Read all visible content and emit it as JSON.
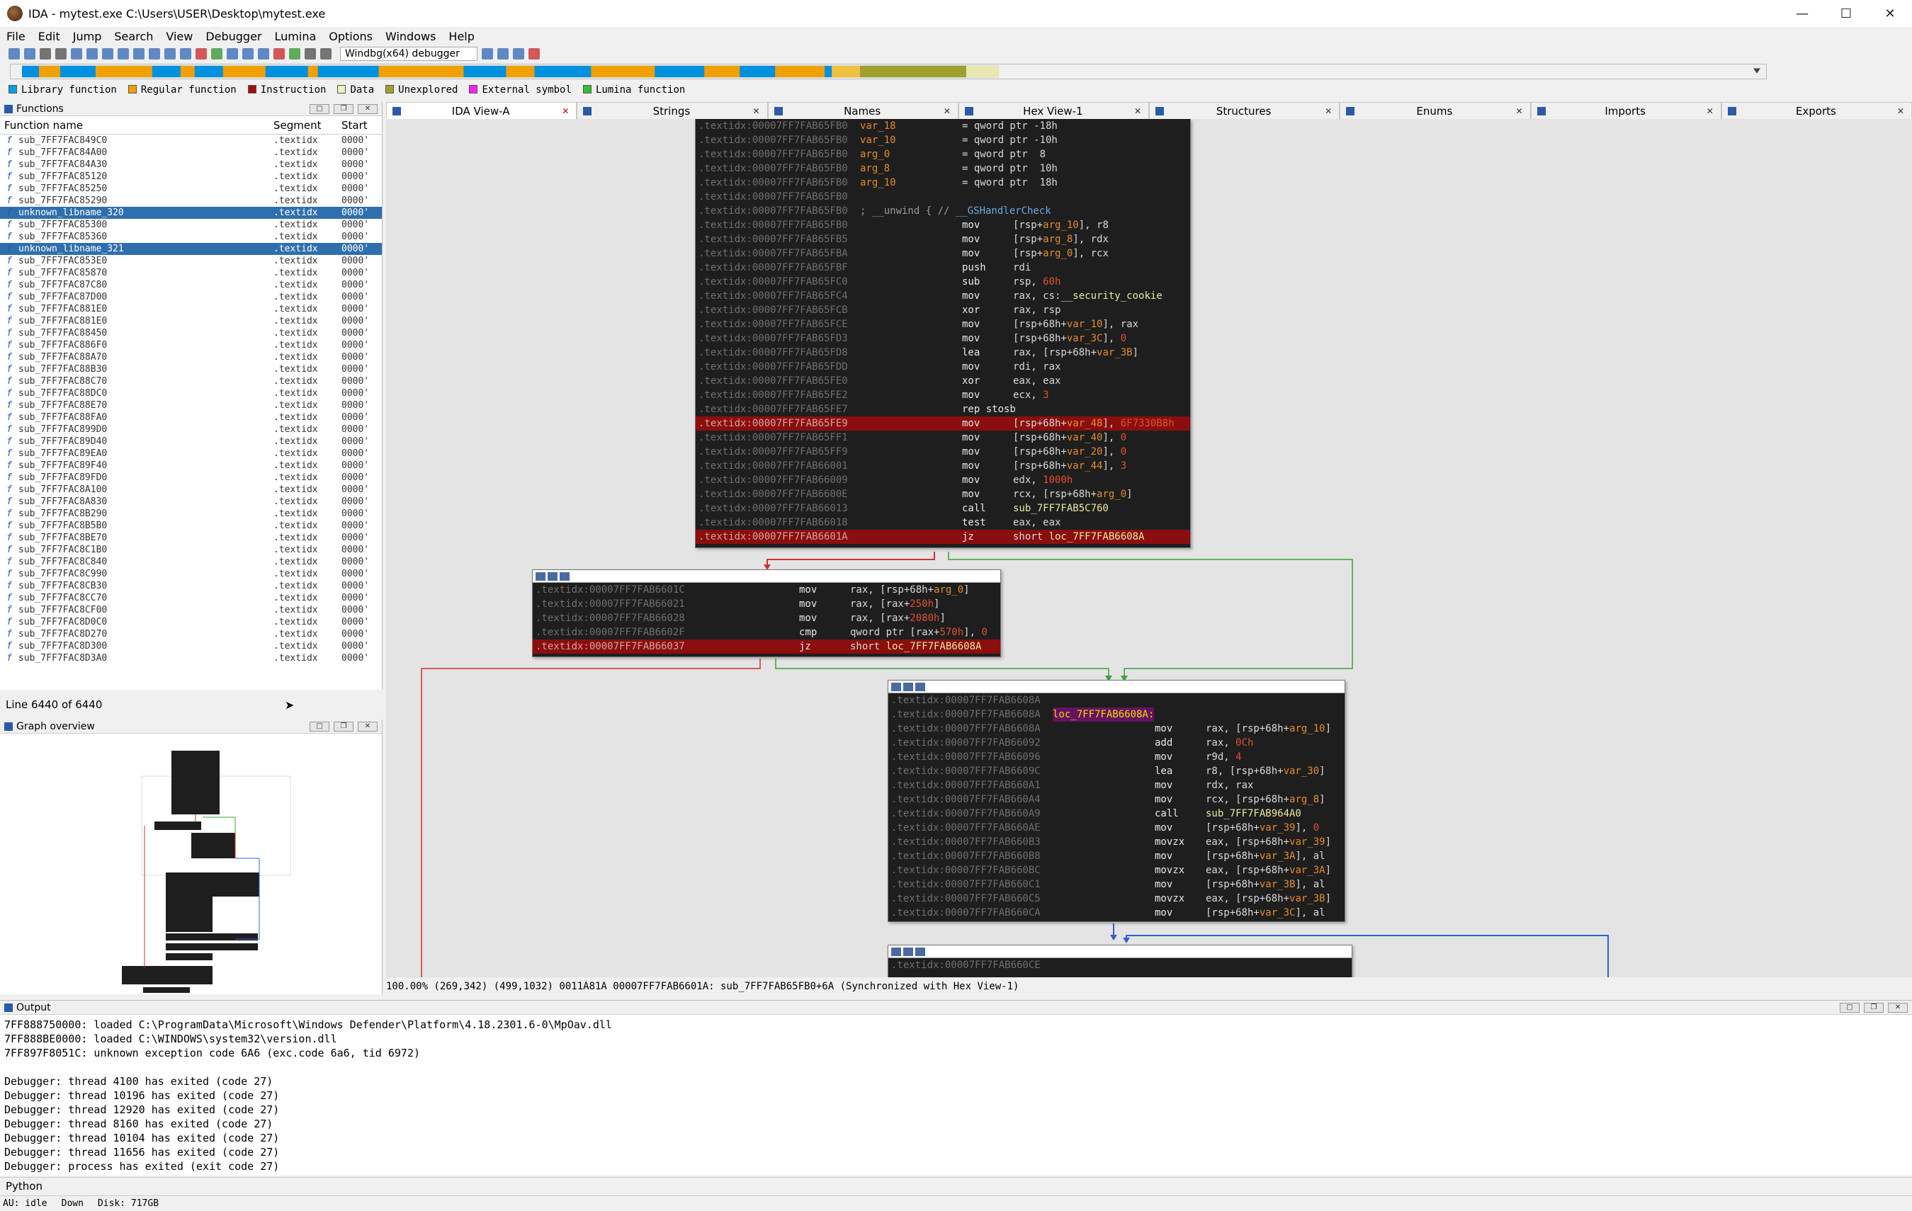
{
  "title": "IDA - mytest.exe C:\\Users\\USER\\Desktop\\mytest.exe",
  "window_controls": {
    "minimize": "—",
    "maximize": "☐",
    "close": "✕"
  },
  "menu": [
    "File",
    "Edit",
    "Jump",
    "Search",
    "View",
    "Debugger",
    "Lumina",
    "Options",
    "Windows",
    "Help"
  ],
  "toolbar": {
    "debugger_select": "Windbg(x64) debugger"
  },
  "legend": [
    {
      "label": "Library function",
      "color": "#00a0e8"
    },
    {
      "label": "Regular function",
      "color": "#f0a000"
    },
    {
      "label": "Instruction",
      "color": "#a01010"
    },
    {
      "label": "Data",
      "color": "#f0f0c0"
    },
    {
      "label": "Unexplored",
      "color": "#a0a030"
    },
    {
      "label": "External symbol",
      "color": "#ff20ff"
    },
    {
      "label": "Lumina function",
      "color": "#30c030"
    }
  ],
  "functions_panel": {
    "title": "Functions",
    "col_name": "Function name",
    "col_segment": "Segment",
    "col_start": "Start",
    "rows": [
      {
        "name": "sub_7FF7FAC849C0",
        "seg": ".textidx",
        "start": "0000'"
      },
      {
        "name": "sub_7FF7FAC84A00",
        "seg": ".textidx",
        "start": "0000'"
      },
      {
        "name": "sub_7FF7FAC84A30",
        "seg": ".textidx",
        "start": "0000'"
      },
      {
        "name": "sub_7FF7FAC85120",
        "seg": ".textidx",
        "start": "0000'"
      },
      {
        "name": "sub_7FF7FAC85250",
        "seg": ".textidx",
        "start": "0000'"
      },
      {
        "name": "sub_7FF7FAC85290",
        "seg": ".textidx",
        "start": "0000'"
      },
      {
        "name": "unknown_libname_320",
        "seg": ".textidx",
        "start": "0000'",
        "sel": true
      },
      {
        "name": "sub_7FF7FAC85300",
        "seg": ".textidx",
        "start": "0000'"
      },
      {
        "name": "sub_7FF7FAC85360",
        "seg": ".textidx",
        "start": "0000'"
      },
      {
        "name": "unknown_libname_321",
        "seg": ".textidx",
        "start": "0000'",
        "sel": true
      },
      {
        "name": "sub_7FF7FAC853E0",
        "seg": ".textidx",
        "start": "0000'"
      },
      {
        "name": "sub_7FF7FAC85870",
        "seg": ".textidx",
        "start": "0000'"
      },
      {
        "name": "sub_7FF7FAC87C80",
        "seg": ".textidx",
        "start": "0000'"
      },
      {
        "name": "sub_7FF7FAC87D00",
        "seg": ".textidx",
        "start": "0000'"
      },
      {
        "name": "sub_7FF7FAC881E0",
        "seg": ".textidx",
        "start": "0000'"
      },
      {
        "name": "sub_7FF7FAC881E0",
        "seg": ".textidx",
        "start": "0000'"
      },
      {
        "name": "sub_7FF7FAC88450",
        "seg": ".textidx",
        "start": "0000'"
      },
      {
        "name": "sub_7FF7FAC886F0",
        "seg": ".textidx",
        "start": "0000'"
      },
      {
        "name": "sub_7FF7FAC88A70",
        "seg": ".textidx",
        "start": "0000'"
      },
      {
        "name": "sub_7FF7FAC88B30",
        "seg": ".textidx",
        "start": "0000'"
      },
      {
        "name": "sub_7FF7FAC88C70",
        "seg": ".textidx",
        "start": "0000'"
      },
      {
        "name": "sub_7FF7FAC88DC0",
        "seg": ".textidx",
        "start": "0000'"
      },
      {
        "name": "sub_7FF7FAC88E70",
        "seg": ".textidx",
        "start": "0000'"
      },
      {
        "name": "sub_7FF7FAC88FA0",
        "seg": ".textidx",
        "start": "0000'"
      },
      {
        "name": "sub_7FF7FAC899D0",
        "seg": ".textidx",
        "start": "0000'"
      },
      {
        "name": "sub_7FF7FAC89D40",
        "seg": ".textidx",
        "start": "0000'"
      },
      {
        "name": "sub_7FF7FAC89EA0",
        "seg": ".textidx",
        "start": "0000'"
      },
      {
        "name": "sub_7FF7FAC89F40",
        "seg": ".textidx",
        "start": "0000'"
      },
      {
        "name": "sub_7FF7FAC89FD0",
        "seg": ".textidx",
        "start": "0000'"
      },
      {
        "name": "sub_7FF7FAC8A100",
        "seg": ".textidx",
        "start": "0000'"
      },
      {
        "name": "sub_7FF7FAC8A830",
        "seg": ".textidx",
        "start": "0000'"
      },
      {
        "name": "sub_7FF7FAC8B290",
        "seg": ".textidx",
        "start": "0000'"
      },
      {
        "name": "sub_7FF7FAC8B5B0",
        "seg": ".textidx",
        "start": "0000'"
      },
      {
        "name": "sub_7FF7FAC8BE70",
        "seg": ".textidx",
        "start": "0000'"
      },
      {
        "name": "sub_7FF7FAC8C1B0",
        "seg": ".textidx",
        "start": "0000'"
      },
      {
        "name": "sub_7FF7FAC8C840",
        "seg": ".textidx",
        "start": "0000'"
      },
      {
        "name": "sub_7FF7FAC8C990",
        "seg": ".textidx",
        "start": "0000'"
      },
      {
        "name": "sub_7FF7FAC8CB30",
        "seg": ".textidx",
        "start": "0000'"
      },
      {
        "name": "sub_7FF7FAC8CC70",
        "seg": ".textidx",
        "start": "0000'"
      },
      {
        "name": "sub_7FF7FAC8CF00",
        "seg": ".textidx",
        "start": "0000'"
      },
      {
        "name": "sub_7FF7FAC8D0C0",
        "seg": ".textidx",
        "start": "0000'"
      },
      {
        "name": "sub_7FF7FAC8D270",
        "seg": ".textidx",
        "start": "0000'"
      },
      {
        "name": "sub_7FF7FAC8D300",
        "seg": ".textidx",
        "start": "0000'"
      },
      {
        "name": "sub_7FF7FAC8D3A0",
        "seg": ".textidx",
        "start": "0000'"
      }
    ],
    "line_count": "Line 6440 of 6440"
  },
  "graph_overview": {
    "title": "Graph overview"
  },
  "tabs": [
    {
      "label": "IDA View-A",
      "active": true
    },
    {
      "label": "Strings"
    },
    {
      "label": "Names"
    },
    {
      "label": "Hex View-1"
    },
    {
      "label": "Structures"
    },
    {
      "label": "Enums"
    },
    {
      "label": "Imports"
    },
    {
      "label": "Exports"
    }
  ],
  "block1": [
    {
      "a": ".textidx:00007FF7FAB65FB0",
      "l": "var_18",
      "m": "= qword ptr -18h",
      "t": "decl"
    },
    {
      "a": ".textidx:00007FF7FAB65FB0",
      "l": "var_10",
      "m": "= qword ptr -10h",
      "t": "decl"
    },
    {
      "a": ".textidx:00007FF7FAB65FB0",
      "l": "arg_0",
      "m": "= qword ptr  8",
      "t": "decl"
    },
    {
      "a": ".textidx:00007FF7FAB65FB0",
      "l": "arg_8",
      "m": "= qword ptr  10h",
      "t": "decl"
    },
    {
      "a": ".textidx:00007FF7FAB65FB0",
      "l": "arg_10",
      "m": "= qword ptr  18h",
      "t": "decl"
    },
    {
      "a": ".textidx:00007FF7FAB65FB0",
      "t": "blank"
    },
    {
      "a": ".textidx:00007FF7FAB65FB0",
      "c": "; __unwind { // ",
      "f": "__GSHandlerCheck",
      "t": "cmt"
    },
    {
      "a": ".textidx:00007FF7FAB65FB0",
      "m": "mov",
      "o": "[rsp+arg_10], r8"
    },
    {
      "a": ".textidx:00007FF7FAB65FB5",
      "m": "mov",
      "o": "[rsp+arg_8], rdx"
    },
    {
      "a": ".textidx:00007FF7FAB65FBA",
      "m": "mov",
      "o": "[rsp+arg_0], rcx"
    },
    {
      "a": ".textidx:00007FF7FAB65FBF",
      "m": "push",
      "o": "rdi"
    },
    {
      "a": ".textidx:00007FF7FAB65FC0",
      "m": "sub",
      "o": "rsp, 60h"
    },
    {
      "a": ".textidx:00007FF7FAB65FC4",
      "m": "mov",
      "o": "rax, cs:__security_cookie"
    },
    {
      "a": ".textidx:00007FF7FAB65FCB",
      "m": "xor",
      "o": "rax, rsp"
    },
    {
      "a": ".textidx:00007FF7FAB65FCE",
      "m": "mov",
      "o": "[rsp+68h+var_10], rax"
    },
    {
      "a": ".textidx:00007FF7FAB65FD3",
      "m": "mov",
      "o": "[rsp+68h+var_3C], 0"
    },
    {
      "a": ".textidx:00007FF7FAB65FD8",
      "m": "lea",
      "o": "rax, [rsp+68h+var_3B]"
    },
    {
      "a": ".textidx:00007FF7FAB65FDD",
      "m": "mov",
      "o": "rdi, rax"
    },
    {
      "a": ".textidx:00007FF7FAB65FE0",
      "m": "xor",
      "o": "eax, eax"
    },
    {
      "a": ".textidx:00007FF7FAB65FE2",
      "m": "mov",
      "o": "ecx, 3"
    },
    {
      "a": ".textidx:00007FF7FAB65FE7",
      "m": "rep stosb",
      "o": ""
    },
    {
      "a": ".textidx:00007FF7FAB65FE9",
      "m": "mov",
      "o": "[rsp+68h+var_48], 6F7330B8h",
      "hl": true
    },
    {
      "a": ".textidx:00007FF7FAB65FF1",
      "m": "mov",
      "o": "[rsp+68h+var_40], 0"
    },
    {
      "a": ".textidx:00007FF7FAB65FF9",
      "m": "mov",
      "o": "[rsp+68h+var_20], 0"
    },
    {
      "a": ".textidx:00007FF7FAB66001",
      "m": "mov",
      "o": "[rsp+68h+var_44], 3"
    },
    {
      "a": ".textidx:00007FF7FAB66009",
      "m": "mov",
      "o": "edx, 1000h"
    },
    {
      "a": ".textidx:00007FF7FAB6600E",
      "m": "mov",
      "o": "rcx, [rsp+68h+arg_0]"
    },
    {
      "a": ".textidx:00007FF7FAB66013",
      "m": "call",
      "o": "sub_7FF7FAB5C760"
    },
    {
      "a": ".textidx:00007FF7FAB66018",
      "m": "test",
      "o": "eax, eax"
    },
    {
      "a": ".textidx:00007FF7FAB6601A",
      "m": "jz",
      "o": "short loc_7FF7FAB6608A",
      "hl": true
    }
  ],
  "block2": [
    {
      "a": ".textidx:00007FF7FAB6601C",
      "m": "mov",
      "o": "rax, [rsp+68h+arg_0]"
    },
    {
      "a": ".textidx:00007FF7FAB66021",
      "m": "mov",
      "o": "rax, [rax+250h]"
    },
    {
      "a": ".textidx:00007FF7FAB66028",
      "m": "mov",
      "o": "rax, [rax+2080h]"
    },
    {
      "a": ".textidx:00007FF7FAB6602F",
      "m": "cmp",
      "o": "qword ptr [rax+570h], 0"
    },
    {
      "a": ".textidx:00007FF7FAB66037",
      "m": "jz",
      "o": "short loc_7FF7FAB6608A",
      "hl": true
    }
  ],
  "block3": [
    {
      "a": ".textidx:00007FF7FAB6608A",
      "t": "blank"
    },
    {
      "a": ".textidx:00007FF7FAB6608A",
      "lb": "loc_7FF7FAB6608A:",
      "t": "label"
    },
    {
      "a": ".textidx:00007FF7FAB6608A",
      "m": "mov",
      "o": "rax, [rsp+68h+arg_10]"
    },
    {
      "a": ".textidx:00007FF7FAB66092",
      "m": "add",
      "o": "rax, 0Ch"
    },
    {
      "a": ".textidx:00007FF7FAB66096",
      "m": "mov",
      "o": "r9d, 4"
    },
    {
      "a": ".textidx:00007FF7FAB6609C",
      "m": "lea",
      "o": "r8, [rsp+68h+var_30]"
    },
    {
      "a": ".textidx:00007FF7FAB660A1",
      "m": "mov",
      "o": "rdx, rax"
    },
    {
      "a": ".textidx:00007FF7FAB660A4",
      "m": "mov",
      "o": "rcx, [rsp+68h+arg_8]"
    },
    {
      "a": ".textidx:00007FF7FAB660A9",
      "m": "call",
      "o": "sub_7FF7FAB964A0"
    },
    {
      "a": ".textidx:00007FF7FAB660AE",
      "m": "mov",
      "o": "[rsp+68h+var_39], 0"
    },
    {
      "a": ".textidx:00007FF7FAB660B3",
      "m": "movzx",
      "o": "eax, [rsp+68h+var_39]"
    },
    {
      "a": ".textidx:00007FF7FAB660B8",
      "m": "mov",
      "o": "[rsp+68h+var_3A], al"
    },
    {
      "a": ".textidx:00007FF7FAB660BC",
      "m": "movzx",
      "o": "eax, [rsp+68h+var_3A]"
    },
    {
      "a": ".textidx:00007FF7FAB660C1",
      "m": "mov",
      "o": "[rsp+68h+var_3B], al"
    },
    {
      "a": ".textidx:00007FF7FAB660C5",
      "m": "movzx",
      "o": "eax, [rsp+68h+var_3B]"
    },
    {
      "a": ".textidx:00007FF7FAB660CA",
      "m": "mov",
      "o": "[rsp+68h+var_3C], al"
    }
  ],
  "block4": [
    {
      "a": ".textidx:00007FF7FAB660CE",
      "t": "blank"
    }
  ],
  "status": "100.00% (269,342) (499,1032) 0011A81A 00007FF7FAB6601A: sub_7FF7FAB65FB0+6A (Synchronized with Hex View-1)",
  "output": {
    "title": "Output",
    "lines": [
      "7FF888750000: loaded C:\\ProgramData\\Microsoft\\Windows Defender\\Platform\\4.18.2301.6-0\\MpOav.dll",
      "7FF888BE0000: loaded C:\\WINDOWS\\system32\\version.dll",
      "7FF897F8051C: unknown exception code 6A6 (exc.code 6a6, tid 6972)",
      "",
      "Debugger: thread 4100 has exited (code 27)",
      "Debugger: thread 10196 has exited (code 27)",
      "Debugger: thread 12920 has exited (code 27)",
      "Debugger: thread 8160 has exited (code 27)",
      "Debugger: thread 10104 has exited (code 27)",
      "Debugger: thread 11656 has exited (code 27)",
      "Debugger: process has exited (exit code 27)"
    ],
    "python_label": "Python"
  },
  "bottom": {
    "au": "AU:  idle",
    "dir": "Down",
    "disk": "Disk: 717GB"
  }
}
